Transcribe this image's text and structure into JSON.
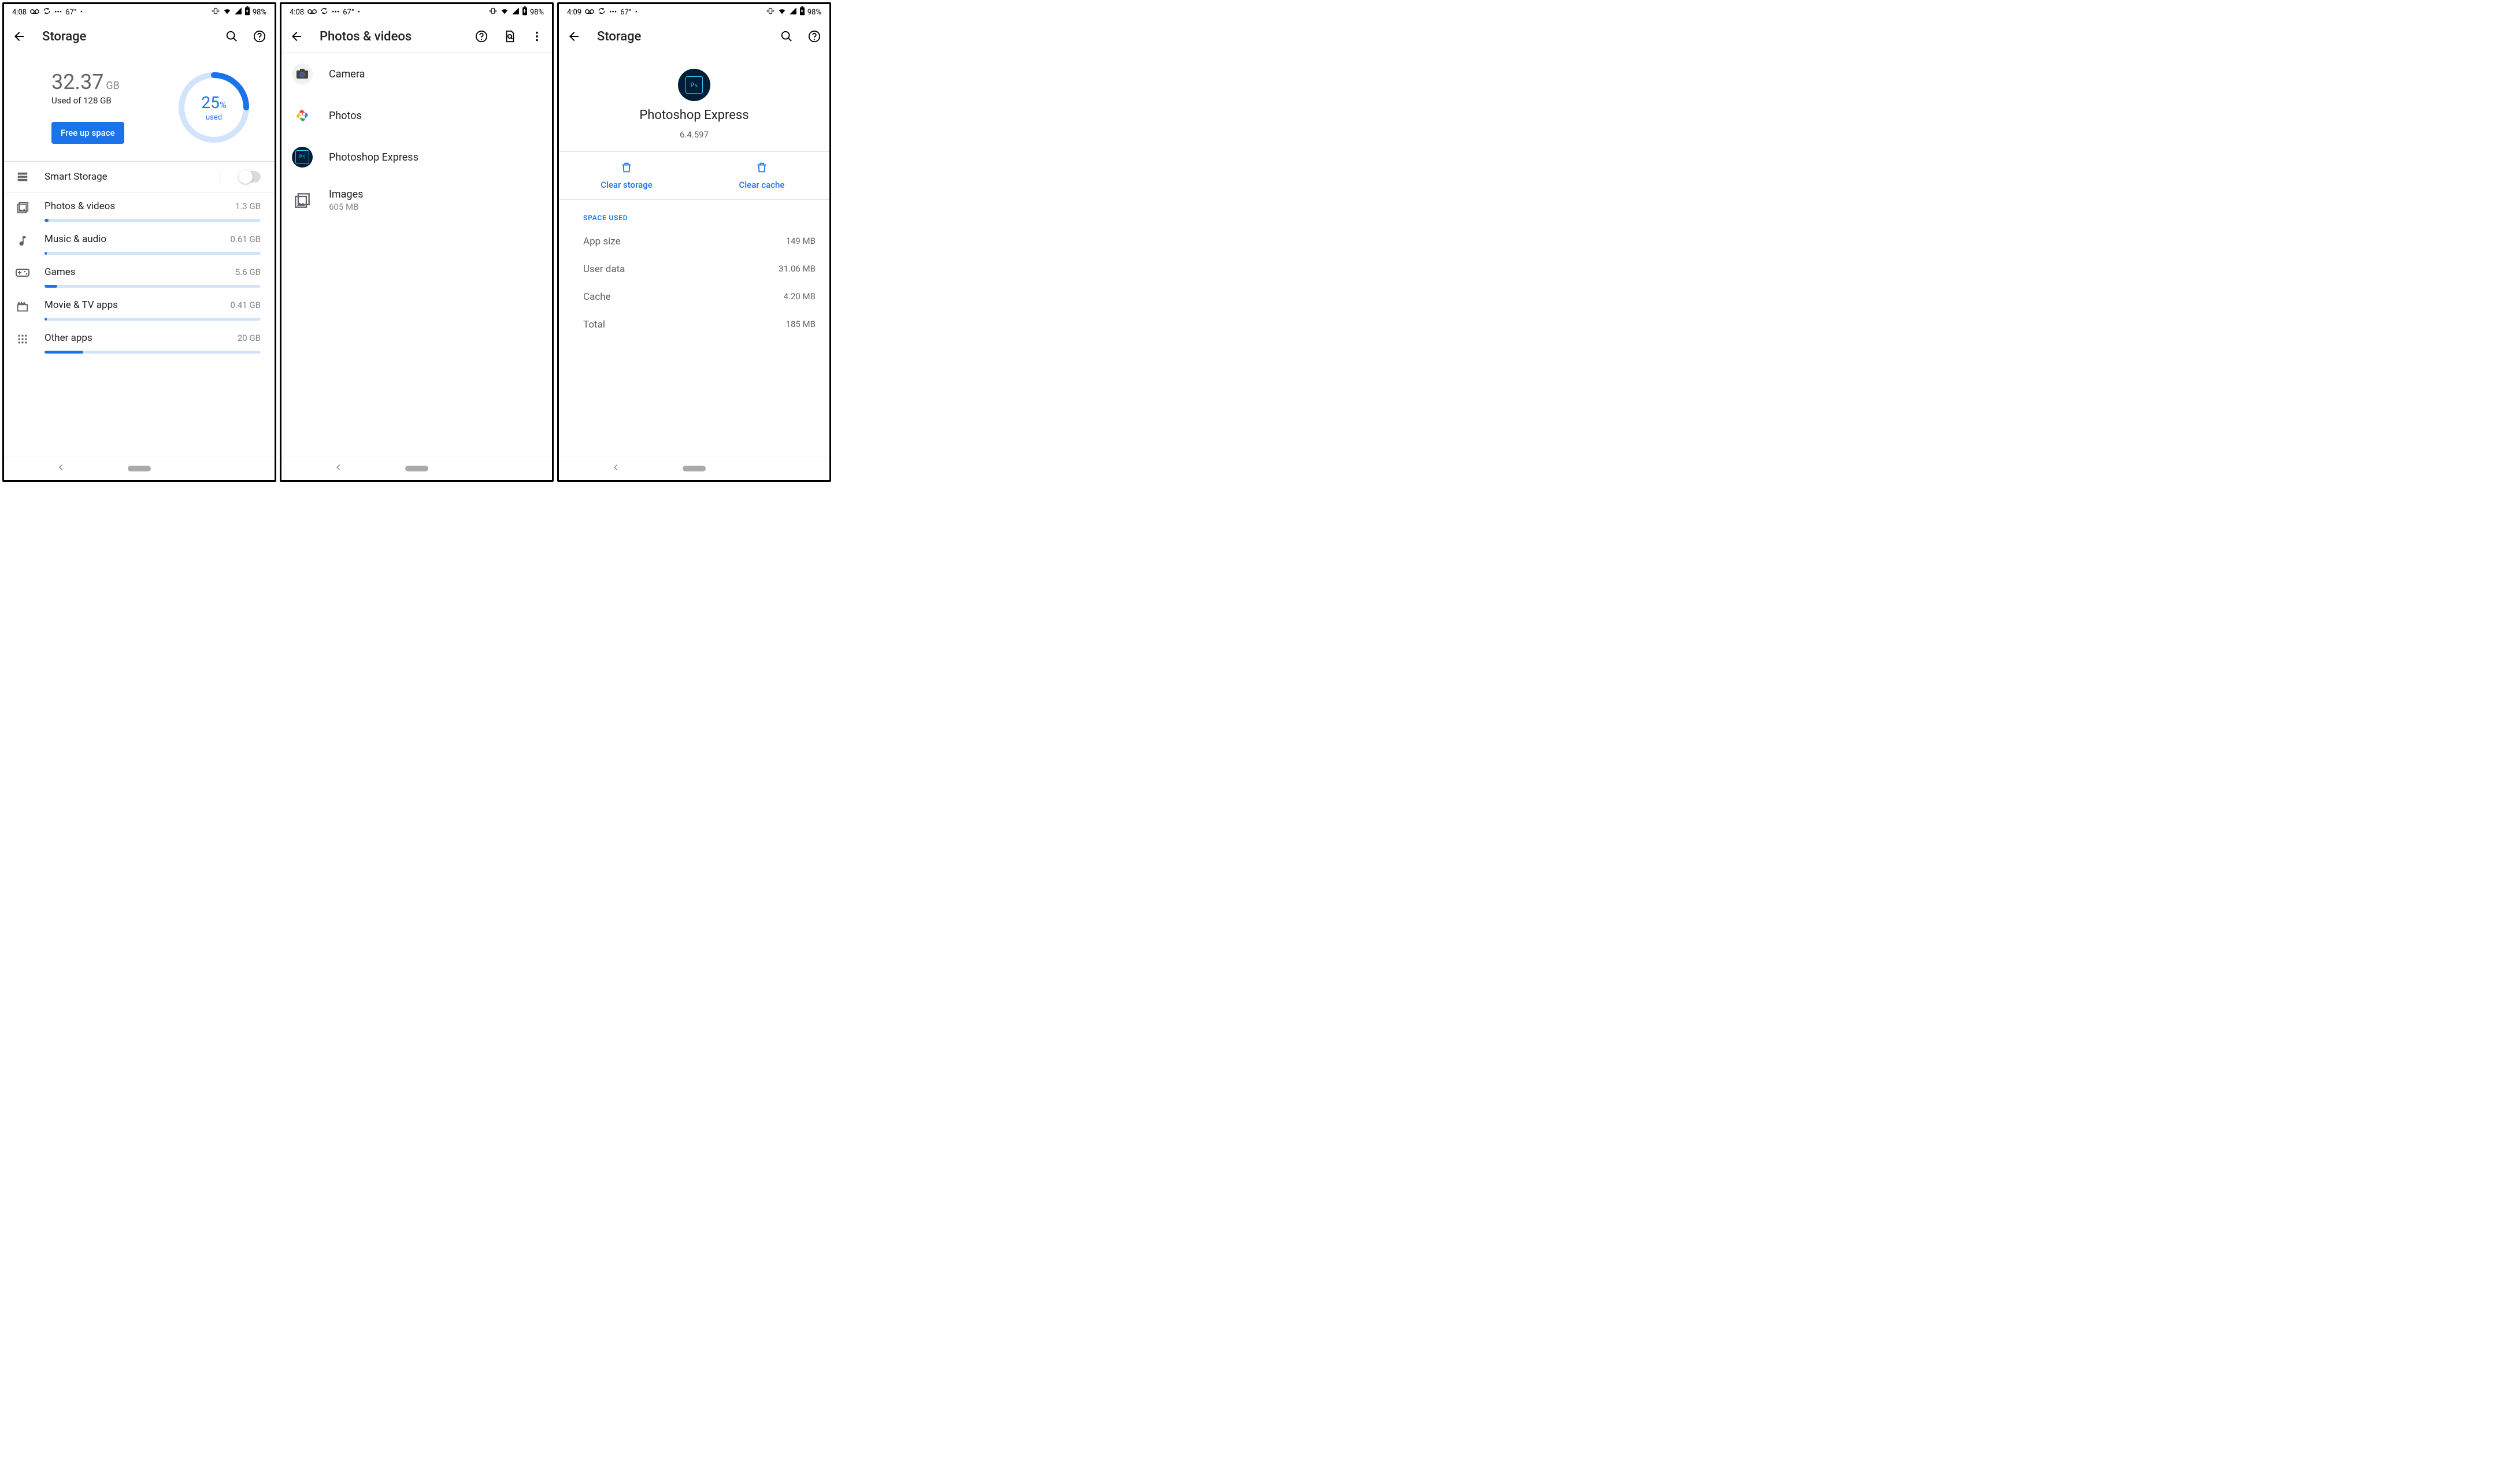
{
  "status": {
    "time1": "4:08",
    "time2": "4:08",
    "time3": "4:09",
    "temp": "67°",
    "battery": "98%"
  },
  "screen1": {
    "title": "Storage",
    "used_value": "32.37",
    "used_unit": "GB",
    "used_sub": "Used of 128 GB",
    "free_btn": "Free up space",
    "pct_value": "25",
    "pct_sign": "%",
    "pct_word": "used",
    "pct_fraction": 0.25,
    "smart_storage": "Smart Storage",
    "categories": [
      {
        "label": "Photos & videos",
        "size": "1.3 GB",
        "fill": 2
      },
      {
        "label": "Music & audio",
        "size": "0.61 GB",
        "fill": 1
      },
      {
        "label": "Games",
        "size": "5.6 GB",
        "fill": 6
      },
      {
        "label": "Movie & TV apps",
        "size": "0.41 GB",
        "fill": 1
      },
      {
        "label": "Other apps",
        "size": "20 GB",
        "fill": 18
      }
    ]
  },
  "screen2": {
    "title": "Photos & videos",
    "items": [
      {
        "label": "Camera"
      },
      {
        "label": "Photos"
      },
      {
        "label": "Photoshop Express"
      },
      {
        "label": "Images",
        "sub": "605 MB"
      }
    ]
  },
  "screen3": {
    "title": "Storage",
    "app_name": "Photoshop Express",
    "app_version": "6.4.597",
    "clear_storage": "Clear storage",
    "clear_cache": "Clear cache",
    "section": "SPACE USED",
    "rows": [
      {
        "k": "App size",
        "v": "149 MB"
      },
      {
        "k": "User data",
        "v": "31.06 MB"
      },
      {
        "k": "Cache",
        "v": "4.20 MB"
      },
      {
        "k": "Total",
        "v": "185 MB"
      }
    ]
  }
}
